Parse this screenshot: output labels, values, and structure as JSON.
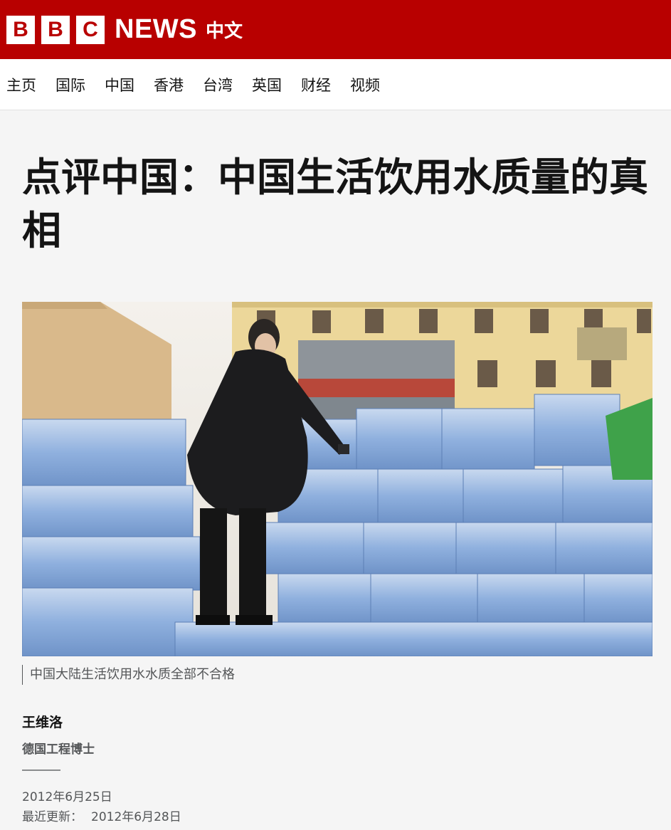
{
  "masthead": {
    "letters": [
      "B",
      "B",
      "C"
    ],
    "news": "NEWS",
    "lang": "中文",
    "color": "#b80000"
  },
  "nav": {
    "items": [
      "主页",
      "国际",
      "中国",
      "香港",
      "台湾",
      "英国",
      "财经",
      "视频"
    ]
  },
  "article": {
    "headline": "点评中国：中国生活饮用水质量的真相",
    "caption": "中国大陆生活饮用水水质全部不合格",
    "author": "王维洛",
    "author_role": "德国工程博士",
    "date": "2012年6月25日",
    "updated_label": "最近更新：",
    "updated_date": "2012年6月28日"
  }
}
